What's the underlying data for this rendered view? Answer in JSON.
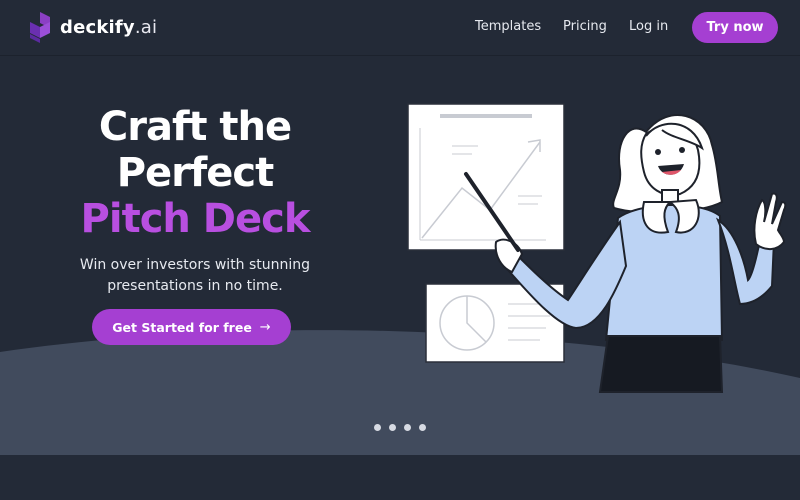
{
  "brand": {
    "name": "deckify",
    "tld": ".ai",
    "accent": "#a53fd2",
    "logo_icon": "stacked-cubes-logo"
  },
  "nav": {
    "templates": "Templates",
    "pricing": "Pricing",
    "login": "Log in",
    "try_now": "Try now"
  },
  "hero": {
    "title_line1": "Craft the",
    "title_line2": "Perfect",
    "title_line3": "Pitch Deck",
    "subtitle": "Win over investors with stunning presentations in no time.",
    "cta_label": "Get Started for free",
    "cta_icon": "arrow-right-icon"
  },
  "carousel": {
    "dot_count": 4
  },
  "colors": {
    "background": "#232a37",
    "wave": "#414b5d",
    "highlight": "#b84fe0"
  }
}
